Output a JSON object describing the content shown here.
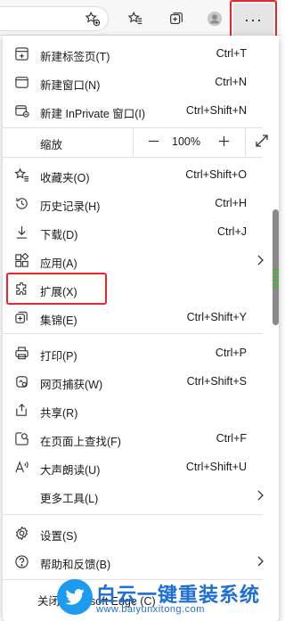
{
  "toolbar": {
    "more_label": "···"
  },
  "menu": {
    "items_top": [
      {
        "icon": "new-tab-icon",
        "label": "新建标签页(T)",
        "shortcut": "Ctrl+T"
      },
      {
        "icon": "new-window-icon",
        "label": "新建窗口(N)",
        "shortcut": "Ctrl+N"
      },
      {
        "icon": "inprivate-icon",
        "label": "新建 InPrivate 窗口(I)",
        "shortcut": "Ctrl+Shift+N"
      }
    ],
    "zoom": {
      "label": "缩放",
      "value": "100%",
      "minus": "—",
      "plus": "+"
    },
    "items_mid": [
      {
        "icon": "favorites-icon",
        "label": "收藏夹(O)",
        "shortcut": "Ctrl+Shift+O"
      },
      {
        "icon": "history-icon",
        "label": "历史记录(H)",
        "shortcut": "Ctrl+H"
      },
      {
        "icon": "download-icon",
        "label": "下载(D)",
        "shortcut": "Ctrl+J"
      },
      {
        "icon": "apps-icon",
        "label": "应用(A)",
        "shortcut": ""
      },
      {
        "icon": "extensions-icon",
        "label": "扩展(X)",
        "shortcut": ""
      },
      {
        "icon": "collections-icon",
        "label": "集锦(E)",
        "shortcut": "Ctrl+Shift+Y"
      }
    ],
    "items_tools": [
      {
        "icon": "print-icon",
        "label": "打印(P)",
        "shortcut": "Ctrl+P"
      },
      {
        "icon": "web-capture-icon",
        "label": "网页捕获(W)",
        "shortcut": "Ctrl+Shift+S"
      },
      {
        "icon": "share-icon",
        "label": "共享(R)",
        "shortcut": ""
      },
      {
        "icon": "find-icon",
        "label": "在页面上查找(F)",
        "shortcut": "Ctrl+F"
      },
      {
        "icon": "read-aloud-icon",
        "label": "大声朗读(U)",
        "shortcut": "Ctrl+Shift+U"
      },
      {
        "icon": "",
        "label": "更多工具(L)",
        "shortcut": ""
      }
    ],
    "items_bottom": [
      {
        "icon": "settings-icon",
        "label": "设置(S)",
        "shortcut": ""
      },
      {
        "icon": "help-icon",
        "label": "帮助和反馈(B)",
        "shortcut": ""
      }
    ],
    "close_label": "关闭 Microsoft Edge (C)"
  },
  "watermark": {
    "title": "白云一键重装系统",
    "url": "www.baiyunxitong.com"
  }
}
